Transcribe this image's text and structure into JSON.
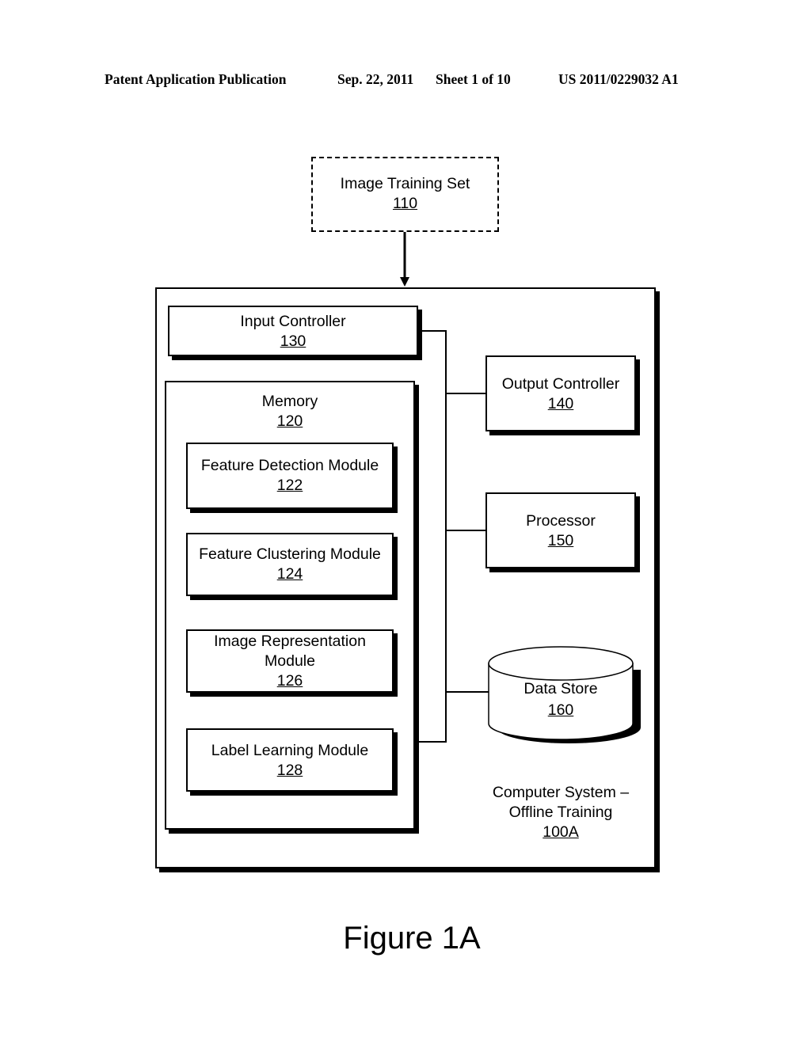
{
  "header": {
    "publication_type": "Patent Application Publication",
    "date": "Sep. 22, 2011",
    "sheet": "Sheet 1 of 10",
    "publication_number": "US 2011/0229032 A1"
  },
  "diagram": {
    "training_set": {
      "label": "Image Training Set",
      "ref": "110"
    },
    "system": {
      "label_line1": "Computer System –",
      "label_line2": "Offline Training",
      "ref": "100A"
    },
    "input_controller": {
      "label": "Input Controller",
      "ref": "130"
    },
    "memory": {
      "label": "Memory",
      "ref": "120"
    },
    "modules": [
      {
        "label": "Feature Detection Module",
        "ref": "122"
      },
      {
        "label": "Feature Clustering Module",
        "ref": "124"
      },
      {
        "label_line1": "Image Representation",
        "label_line2": "Module",
        "ref": "126"
      },
      {
        "label": "Label Learning Module",
        "ref": "128"
      }
    ],
    "output_controller": {
      "label": "Output Controller",
      "ref": "140"
    },
    "processor": {
      "label": "Processor",
      "ref": "150"
    },
    "data_store": {
      "label": "Data Store",
      "ref": "160"
    }
  },
  "caption": "Figure 1A"
}
